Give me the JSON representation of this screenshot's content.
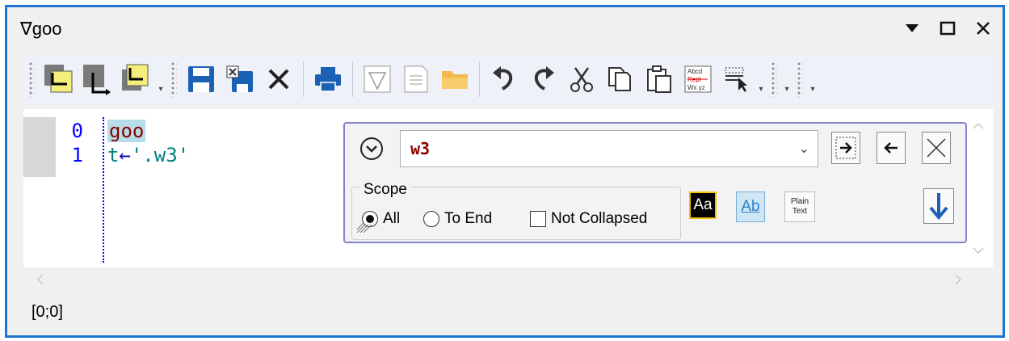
{
  "window": {
    "title": "∇goo"
  },
  "editor": {
    "lines": [
      {
        "num": "0",
        "code": "goo"
      },
      {
        "num": "1",
        "code_prefix": "t",
        "arrow": "←",
        "code_rest": "'.w3'"
      }
    ]
  },
  "find": {
    "search_value": "w3",
    "scope_label": "Scope",
    "option_all": "All",
    "option_to_end": "To End",
    "option_not_collapsed": "Not Collapsed",
    "match_case_label": "Aa",
    "whole_word_label": "Ab",
    "plain_text_line1": "Plain",
    "plain_text_line2": "Text"
  },
  "status": {
    "position": "[0;0]"
  },
  "colors": {
    "border_accent": "#1f74d1",
    "find_border": "#7f83c9",
    "line_numbers": "#0000ff",
    "function_name": "#8b0000",
    "string": "#008080"
  }
}
